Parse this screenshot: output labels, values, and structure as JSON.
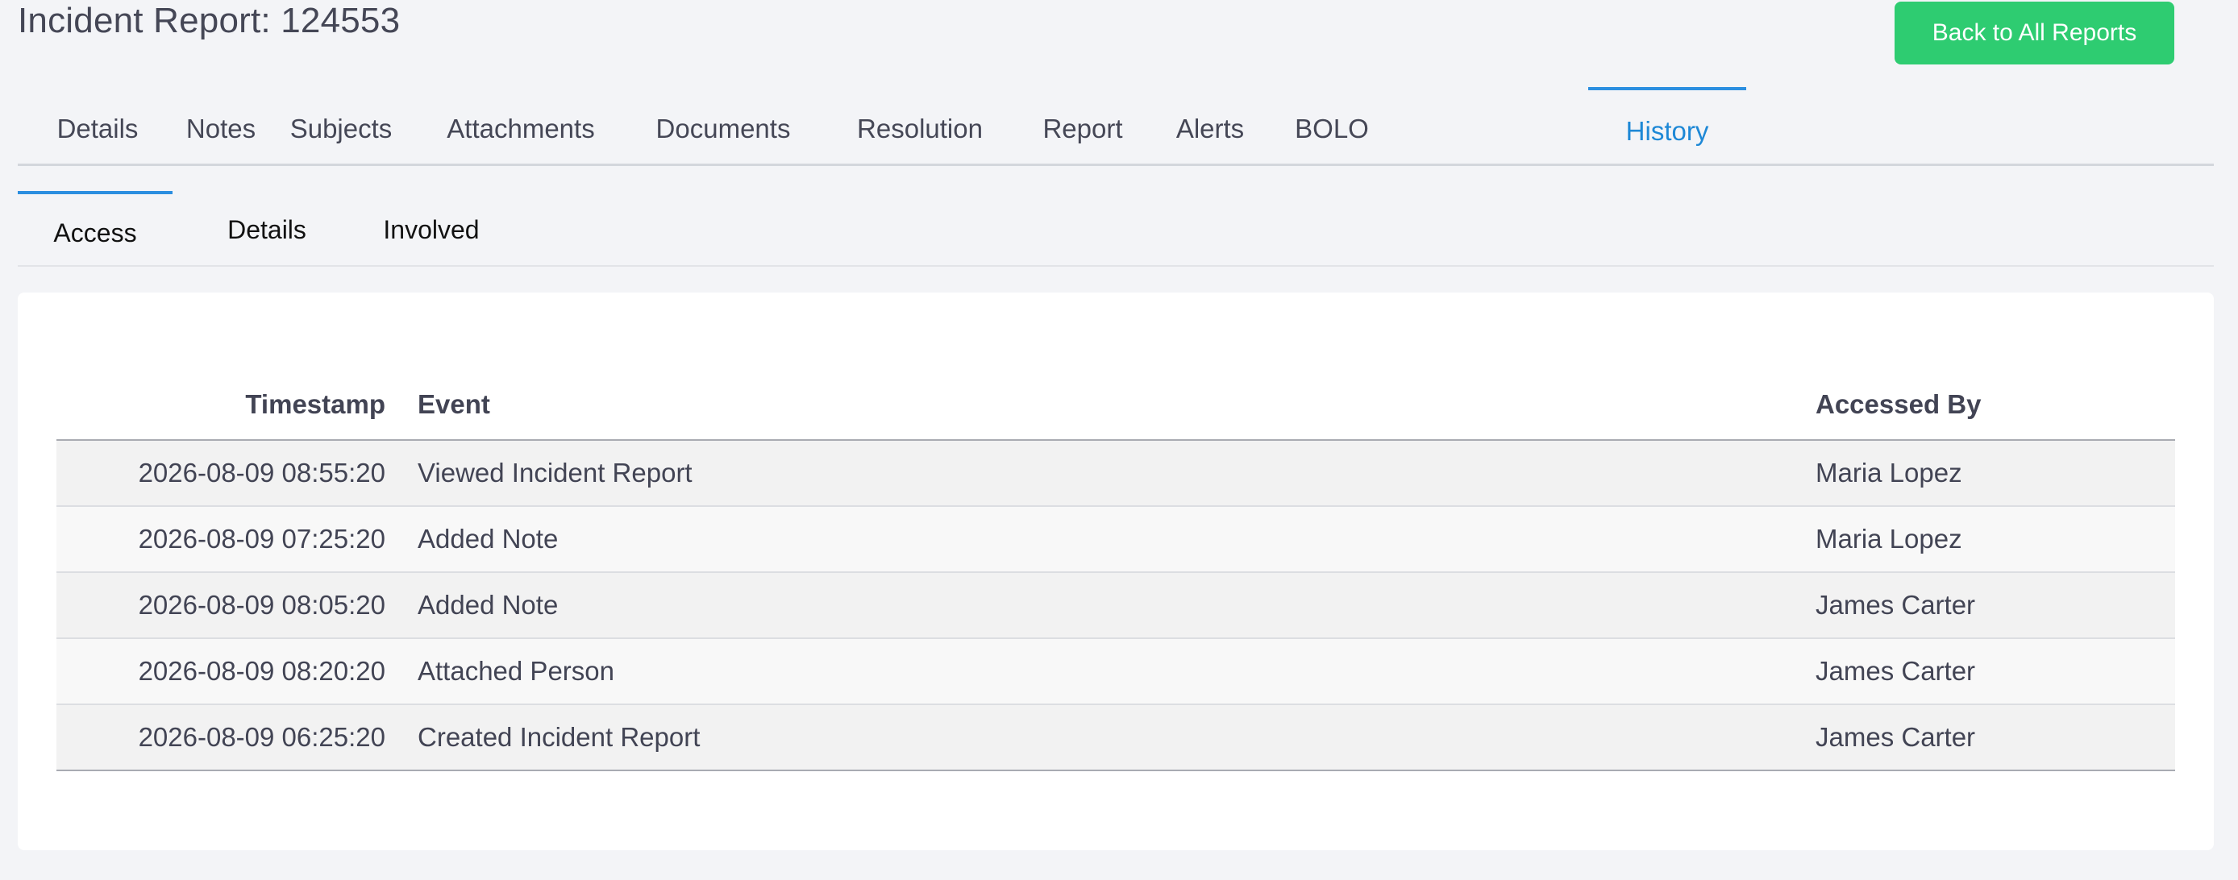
{
  "header": {
    "title": "Incident Report: 124553",
    "back_button_label": "Back to All Reports"
  },
  "main_tabs": [
    {
      "label": "Details"
    },
    {
      "label": "Notes"
    },
    {
      "label": "Subjects"
    },
    {
      "label": "Attachments"
    },
    {
      "label": "Documents"
    },
    {
      "label": "Resolution"
    },
    {
      "label": "Report"
    },
    {
      "label": "Alerts"
    },
    {
      "label": "BOLO"
    },
    {
      "label": "History",
      "active": true
    }
  ],
  "sub_tabs": [
    {
      "label": "Access",
      "active": true
    },
    {
      "label": "Details"
    },
    {
      "label": "Involved"
    }
  ],
  "table": {
    "columns": [
      "Timestamp",
      "Event",
      "Accessed By"
    ],
    "rows": [
      {
        "timestamp": "2026-08-09 08:55:20",
        "event": "Viewed Incident Report",
        "accessed_by": "Maria Lopez"
      },
      {
        "timestamp": "2026-08-09 07:25:20",
        "event": "Added Note",
        "accessed_by": "Maria Lopez"
      },
      {
        "timestamp": "2026-08-09 08:05:20",
        "event": "Added Note",
        "accessed_by": "James Carter"
      },
      {
        "timestamp": "2026-08-09 08:20:20",
        "event": "Attached Person",
        "accessed_by": "James Carter"
      },
      {
        "timestamp": "2026-08-09 06:25:20",
        "event": "Created Incident Report",
        "accessed_by": "James Carter"
      }
    ]
  },
  "colors": {
    "accent": "#2b8ee0",
    "primary_button": "#2ecc71",
    "background": "#f3f4f7"
  }
}
